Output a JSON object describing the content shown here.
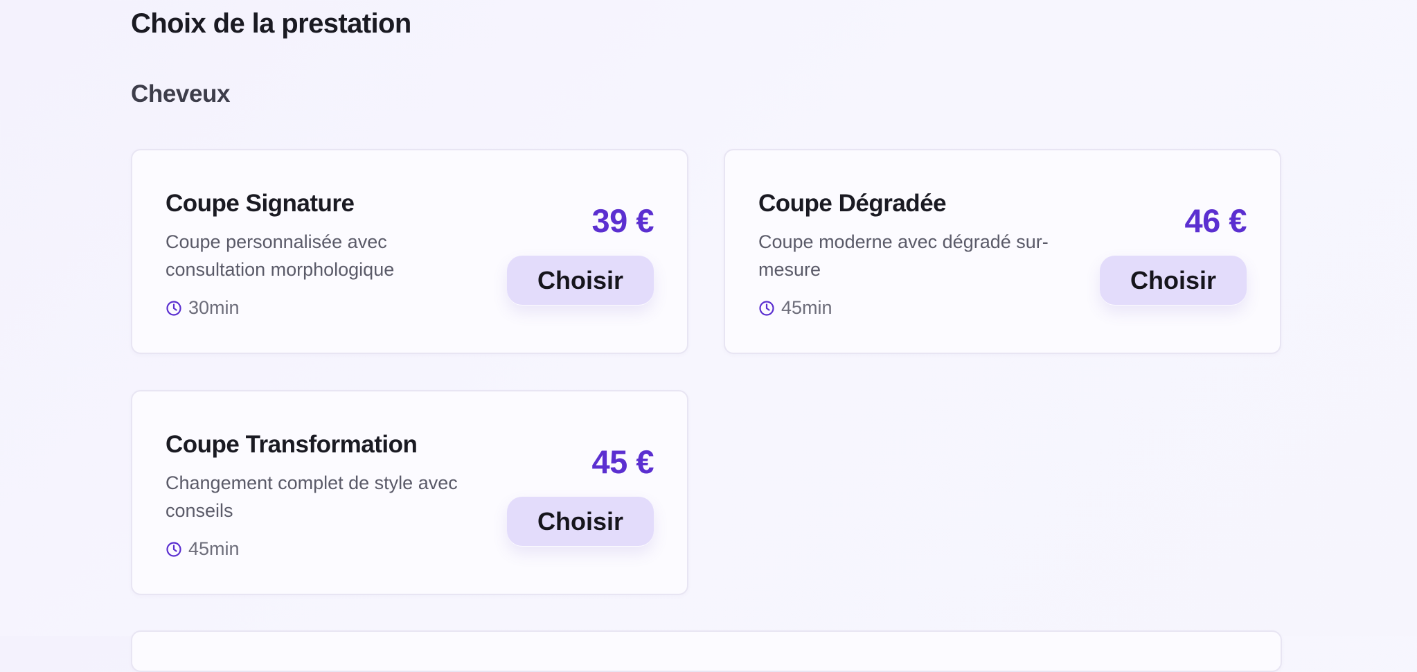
{
  "page": {
    "title": "Choix de la prestation"
  },
  "section": {
    "title": "Cheveux"
  },
  "accent_color": "#5b2fd0",
  "button_bg_color": "#e3dcfb",
  "services": [
    {
      "name": "Coupe Signature",
      "description": "Coupe personnalisée avec consultation morphologique",
      "duration": "30min",
      "duration_icon": "clock-icon",
      "price": "39 €",
      "button_label": "Choisir"
    },
    {
      "name": "Coupe Dégradée",
      "description": "Coupe moderne avec dégradé sur-mesure",
      "duration": "45min",
      "duration_icon": "clock-icon",
      "price": "46 €",
      "button_label": "Choisir"
    },
    {
      "name": "Coupe Transformation",
      "description": "Changement complet de style avec conseils",
      "duration": "45min",
      "duration_icon": "clock-icon",
      "price": "45 €",
      "button_label": "Choisir"
    }
  ]
}
